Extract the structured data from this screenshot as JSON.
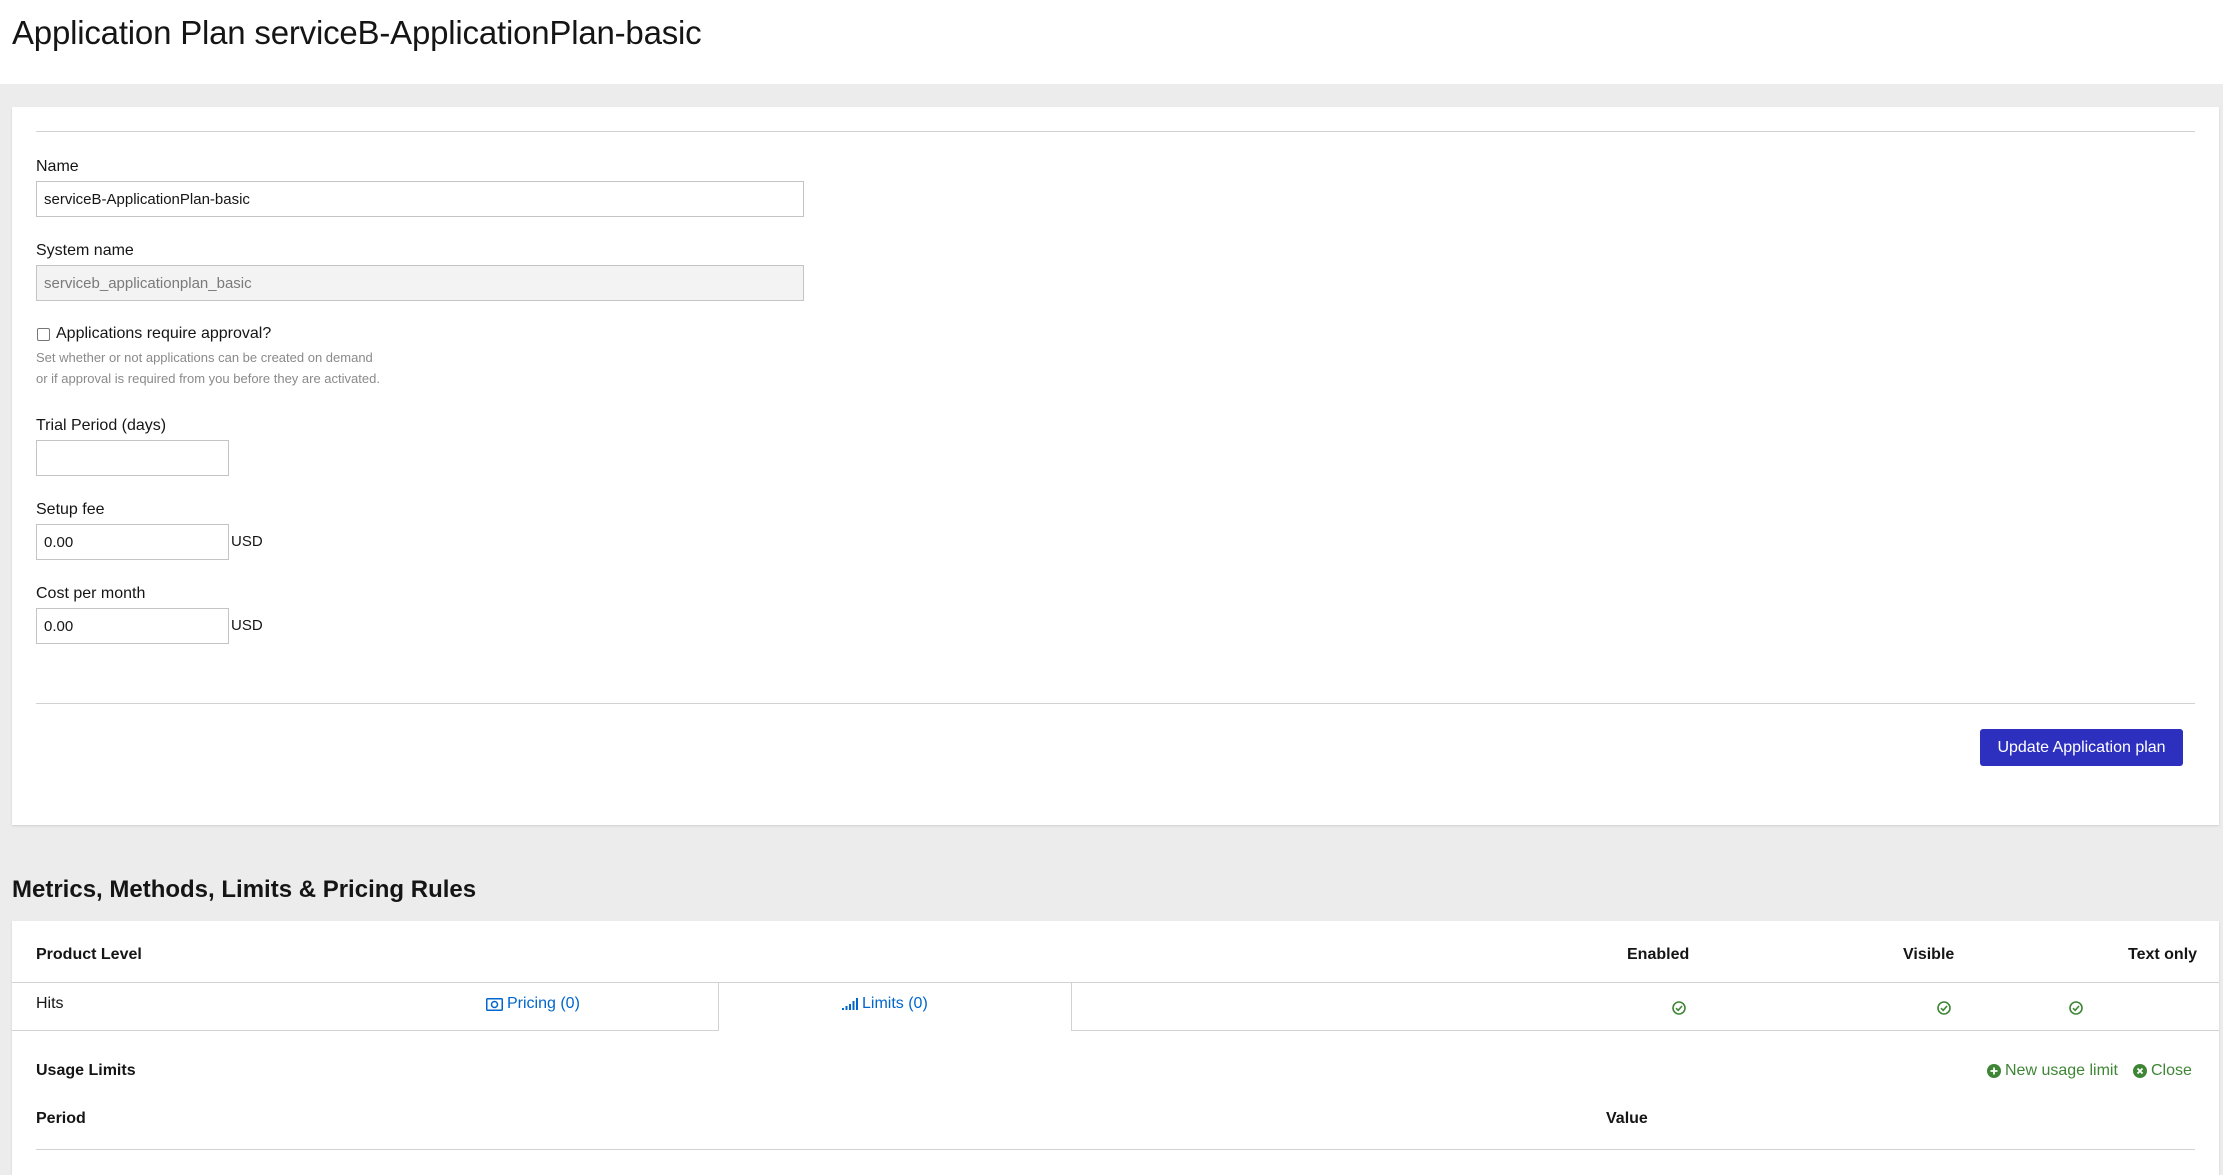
{
  "header": {
    "title": "Application Plan serviceB-ApplicationPlan-basic"
  },
  "form": {
    "name_label": "Name",
    "name_value": "serviceB-ApplicationPlan-basic",
    "system_name_label": "System name",
    "system_name_value": "serviceb_applicationplan_basic",
    "approval_label": "Applications require approval?",
    "approval_checked": false,
    "approval_help_1": "Set whether or not applications can be created on demand",
    "approval_help_2": "or if approval is required from you before they are activated.",
    "trial_label": "Trial Period (days)",
    "trial_value": "",
    "setup_fee_label": "Setup fee",
    "setup_fee_value": "0.00",
    "setup_fee_unit": "USD",
    "cost_label": "Cost per month",
    "cost_value": "0.00",
    "cost_unit": "USD",
    "submit_label": "Update Application plan"
  },
  "metrics": {
    "section_title": "Metrics, Methods, Limits & Pricing Rules",
    "columns": {
      "product_level": "Product Level",
      "enabled": "Enabled",
      "visible": "Visible",
      "text_only": "Text only"
    },
    "rows": [
      {
        "name": "Hits",
        "pricing_label": "Pricing (0)",
        "limits_label": "Limits (0)",
        "enabled": true,
        "visible": true,
        "text_only": true
      }
    ],
    "usage_limits": {
      "title": "Usage Limits",
      "new_limit_label": "New usage limit",
      "close_label": "Close",
      "period_header": "Period",
      "value_header": "Value"
    }
  },
  "colors": {
    "primary": "#2d2fbf",
    "link": "#0066cc",
    "success": "#3e8635",
    "background": "#ececec"
  }
}
